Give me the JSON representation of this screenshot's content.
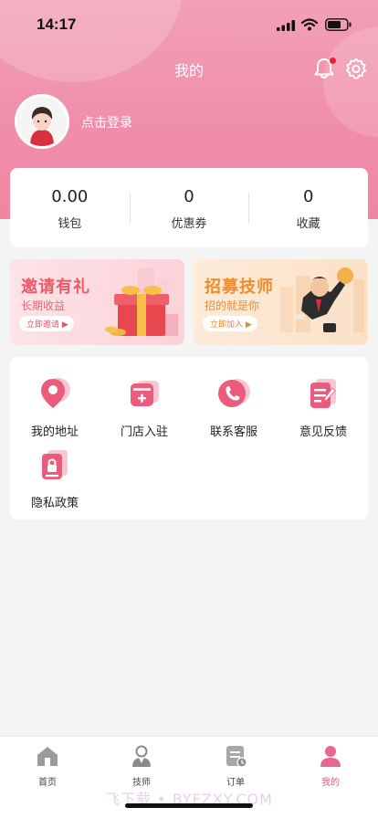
{
  "status": {
    "time": "14:17"
  },
  "header": {
    "title": "我的"
  },
  "profile": {
    "login_text": "点击登录"
  },
  "stats": [
    {
      "value": "0.00",
      "label": "钱包"
    },
    {
      "value": "0",
      "label": "优惠券"
    },
    {
      "value": "0",
      "label": "收藏"
    }
  ],
  "banners": [
    {
      "title": "邀请有礼",
      "subtitle": "长期收益",
      "button": "立即邀请"
    },
    {
      "title": "招募技师",
      "subtitle": "招的就是你",
      "button": "立即加入"
    }
  ],
  "menu": [
    {
      "label": "我的地址",
      "icon": "location-icon"
    },
    {
      "label": "门店入驻",
      "icon": "store-join-icon"
    },
    {
      "label": "联系客服",
      "icon": "phone-icon"
    },
    {
      "label": "意见反馈",
      "icon": "feedback-icon"
    },
    {
      "label": "隐私政策",
      "icon": "privacy-icon"
    }
  ],
  "tabs": [
    {
      "label": "首页",
      "icon": "home-icon"
    },
    {
      "label": "技师",
      "icon": "technician-icon"
    },
    {
      "label": "订单",
      "icon": "order-icon"
    },
    {
      "label": "我的",
      "icon": "profile-icon"
    }
  ],
  "active_tab": "我的",
  "watermark": "飞下载 • BYFZXY.COM",
  "colors": {
    "accent": "#ee86a3",
    "active_tab": "#e45d84"
  }
}
